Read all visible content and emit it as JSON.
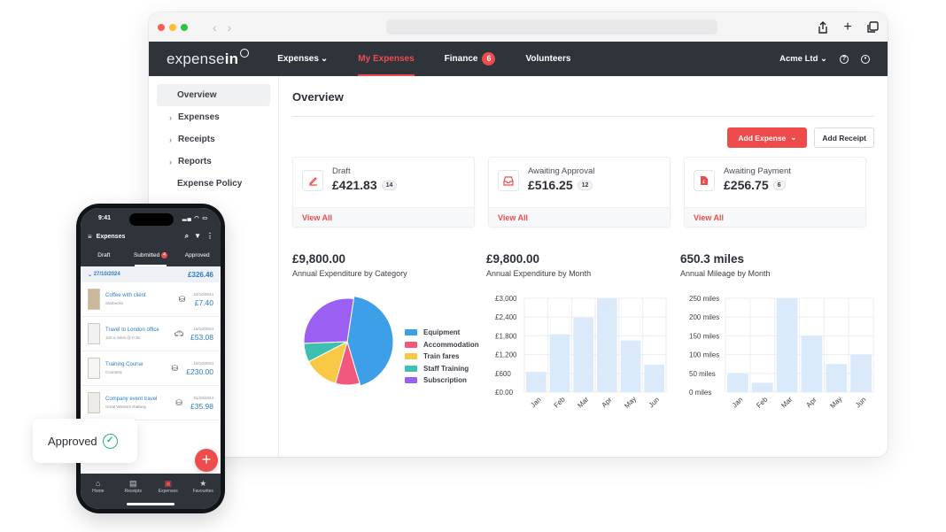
{
  "browser": {
    "colors": {
      "red": "#ff5f57",
      "yellow": "#febc2e",
      "green": "#28c840"
    }
  },
  "nav": {
    "logo_main": "expense",
    "logo_accent": "in",
    "links": [
      {
        "label": "Expenses",
        "caret": "⌄"
      },
      {
        "label": "My Expenses"
      },
      {
        "label": "Finance",
        "badge": "6"
      },
      {
        "label": "Volunteers"
      }
    ],
    "org": "Acme Ltd",
    "org_caret": "⌄"
  },
  "sidebar": {
    "items": [
      {
        "label": "Overview"
      },
      {
        "label": "Expenses"
      },
      {
        "label": "Receipts"
      },
      {
        "label": "Reports"
      },
      {
        "label": "Expense Policy"
      }
    ]
  },
  "main": {
    "title": "Overview",
    "add_expense": "Add Expense",
    "add_receipt": "Add Receipt",
    "cards": [
      {
        "label": "Draft",
        "amount": "£421.83",
        "count": "14",
        "link": "View All"
      },
      {
        "label": "Awaiting Approval",
        "amount": "£516.25",
        "count": "12",
        "link": "View All"
      },
      {
        "label": "Awaiting Payment",
        "amount": "£256.75",
        "count": "6",
        "link": "View All"
      }
    ],
    "stats": [
      {
        "value": "£9,800.00",
        "label": "Annual Expenditure by Category"
      },
      {
        "value": "£9,800.00",
        "label": "Annual Expenditure by Month"
      },
      {
        "value": "650.3 miles",
        "label": "Annual Mileage by Month"
      }
    ]
  },
  "chart_data": [
    {
      "type": "pie",
      "title": "Annual Expenditure by Category",
      "categories": [
        "Equipment",
        "Accommodation",
        "Train fares",
        "Staff Training",
        "Subscription"
      ],
      "values": [
        43,
        9,
        13,
        7,
        28
      ],
      "colors": [
        "#3d9fe8",
        "#f2587d",
        "#f9c945",
        "#3fbfb0",
        "#9b5ff2"
      ]
    },
    {
      "type": "bar",
      "title": "Annual Expenditure by Month",
      "categories": [
        "Jan",
        "Feb",
        "Mar",
        "Apr",
        "May",
        "Jun"
      ],
      "values": [
        650,
        1850,
        2380,
        3000,
        1650,
        880
      ],
      "ylim": [
        0,
        3000
      ],
      "yticks": [
        "£3,000",
        "£2,400",
        "£1,800",
        "£1,200",
        "£600",
        "£0.00"
      ],
      "color": "#dbeafb"
    },
    {
      "type": "bar",
      "title": "Annual Mileage by Month",
      "categories": [
        "Jan",
        "Feb",
        "Mar",
        "Apr",
        "May",
        "Jun"
      ],
      "values": [
        50,
        25,
        250,
        150,
        75,
        100
      ],
      "ylim": [
        0,
        250
      ],
      "yticks": [
        "250 miles",
        "200 miles",
        "150 miles",
        "100 miles",
        "50 miles",
        "0 miles"
      ],
      "color": "#dbeafb"
    }
  ],
  "phone": {
    "time": "9:41",
    "header": "Expenses",
    "tabs": [
      {
        "label": "Draft"
      },
      {
        "label": "Submitted",
        "badge": "4"
      },
      {
        "label": "Approved"
      }
    ],
    "group": {
      "date": "27/10/2024",
      "amount": "£326.46"
    },
    "rows": [
      {
        "title": "Coffee with client",
        "sub": "Starbucks",
        "date": "22/10/2024",
        "amount": "£7.40",
        "cat_icon": "coins-icon"
      },
      {
        "title": "Travel to London office",
        "sub": "120.4 miles @ 0.45",
        "date": "15/10/2024",
        "amount": "£53.08",
        "cat_icon": "car-icon"
      },
      {
        "title": "Training Course",
        "sub": "Coursera",
        "date": "10/10/2024",
        "amount": "£230.00",
        "cat_icon": "coins-icon"
      },
      {
        "title": "Company event travel",
        "sub": "Great Western Railway",
        "date": "01/10/2024",
        "amount": "£35.98",
        "cat_icon": "coins-icon"
      }
    ],
    "bottom_nav": [
      {
        "label": "Home"
      },
      {
        "label": "Receipts"
      },
      {
        "label": "Expenses"
      },
      {
        "label": "Favourites"
      }
    ]
  },
  "toast": {
    "label": "Approved"
  }
}
